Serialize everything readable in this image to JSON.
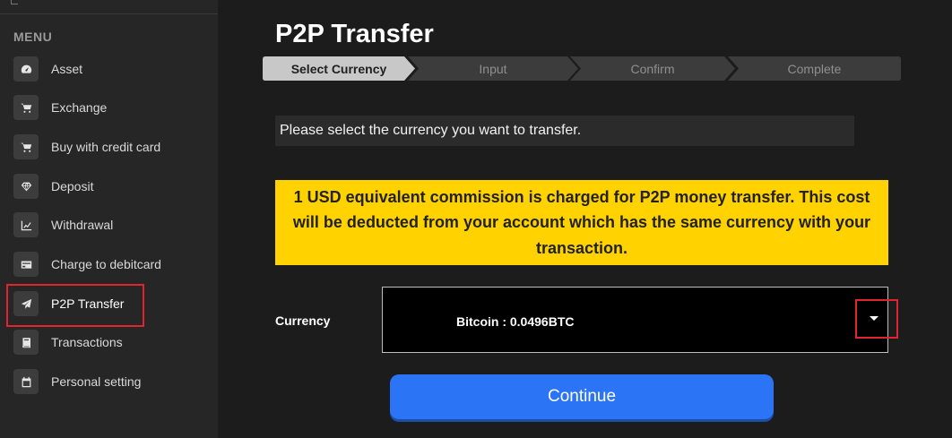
{
  "sidebar": {
    "menu_title": "MENU",
    "items": [
      {
        "label": "Asset",
        "icon": "gauge-icon"
      },
      {
        "label": "Exchange",
        "icon": "cart-icon"
      },
      {
        "label": "Buy with credit card",
        "icon": "cart-icon"
      },
      {
        "label": "Deposit",
        "icon": "diamond-icon"
      },
      {
        "label": "Withdrawal",
        "icon": "chart-icon"
      },
      {
        "label": "Charge to debitcard",
        "icon": "card-icon"
      },
      {
        "label": "P2P Transfer",
        "icon": "paper-plane-icon",
        "active": true
      },
      {
        "label": "Transactions",
        "icon": "book-icon"
      },
      {
        "label": "Personal setting",
        "icon": "calendar-icon"
      }
    ],
    "highlight_color": "#e0252e"
  },
  "main": {
    "title": "P2P Transfer",
    "steps": [
      {
        "label": "Select Currency",
        "active": true
      },
      {
        "label": "Input",
        "active": false
      },
      {
        "label": "Confirm",
        "active": false
      },
      {
        "label": "Complete",
        "active": false
      }
    ],
    "instruction": "Please select the currency you want to transfer.",
    "notice": "1 USD equivalent commission is charged for P2P money transfer. This cost will be deducted from your account which has the same currency with your transaction.",
    "currency_label": "Currency",
    "currency_value": "Bitcoin : 0.0496BTC",
    "continue_label": "Continue"
  },
  "colors": {
    "accent": "#2a74f5",
    "notice_bg": "#ffd200",
    "highlight": "#e0252e"
  }
}
